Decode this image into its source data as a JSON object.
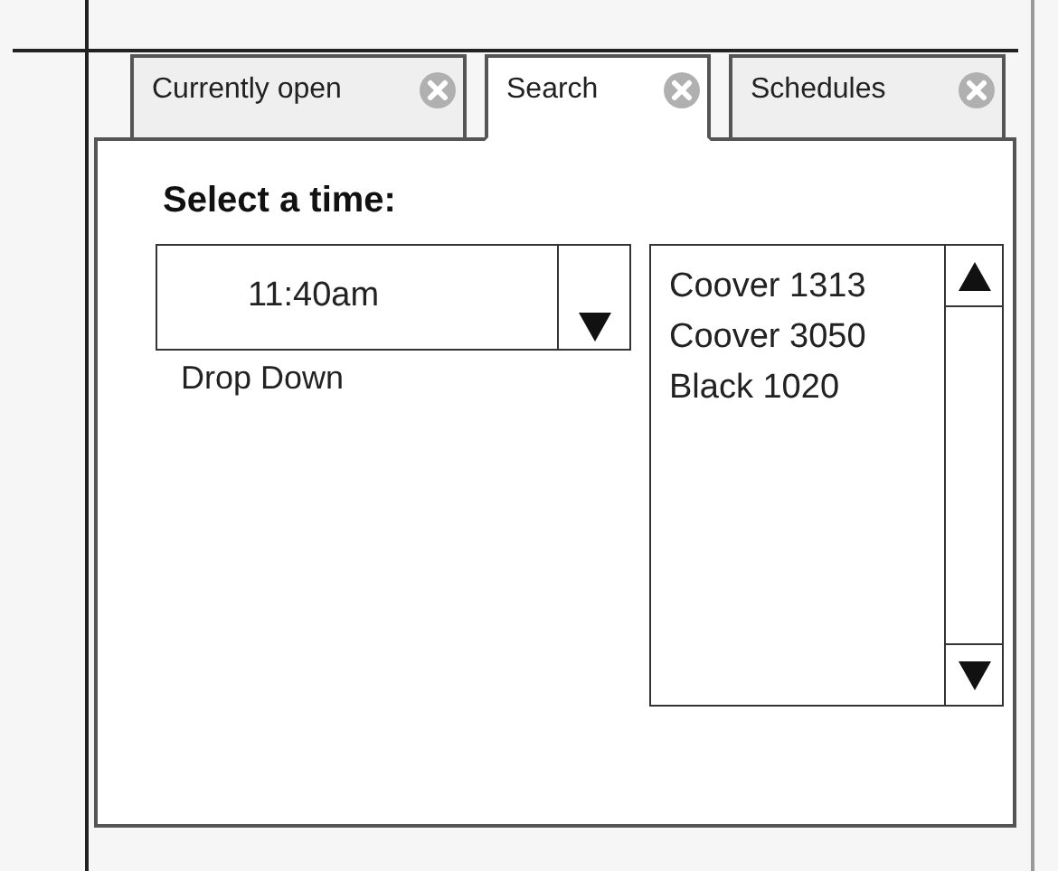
{
  "tabs": [
    {
      "label": "Currently open",
      "selected": false
    },
    {
      "label": "Search",
      "selected": true
    },
    {
      "label": "Schedules",
      "selected": false
    }
  ],
  "panel": {
    "title": "Select a time:",
    "dropdown": {
      "value": "11:40am",
      "label": "Drop Down"
    },
    "list": {
      "items": [
        "Coover 1313",
        "Coover 3050",
        "Black 1020"
      ]
    }
  }
}
